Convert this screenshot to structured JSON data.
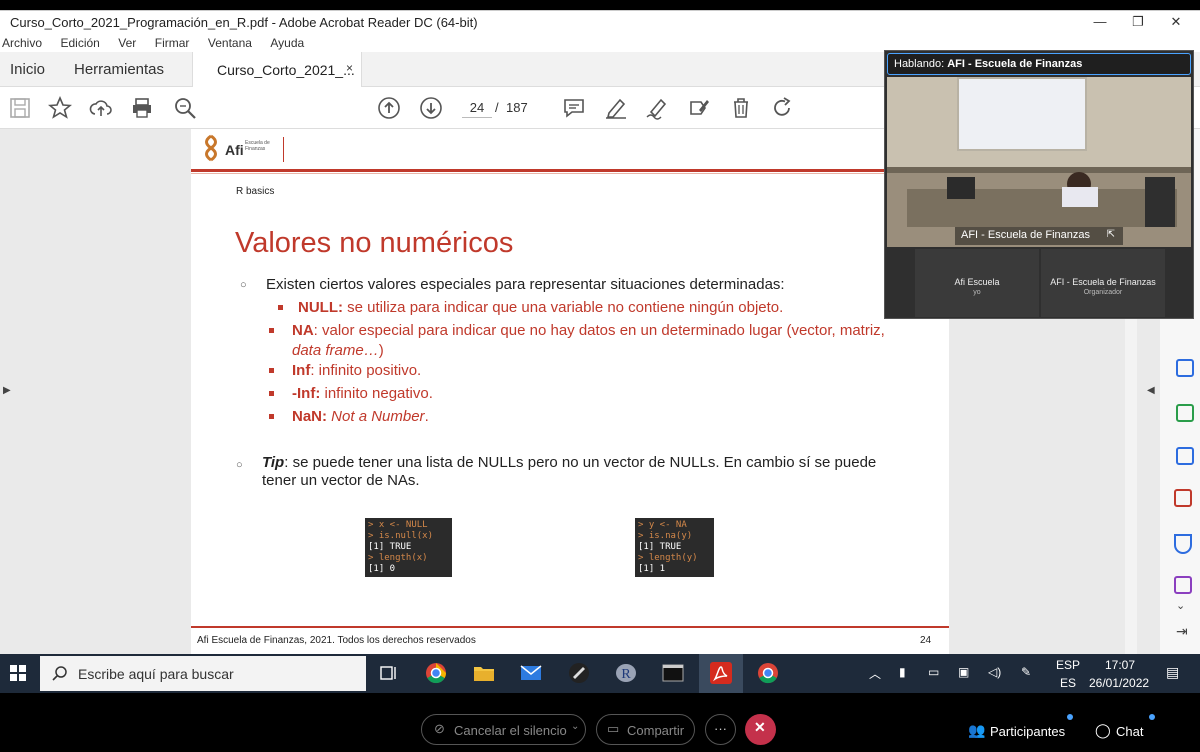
{
  "window": {
    "title": "Curso_Corto_2021_Programación_en_R.pdf - Adobe Acrobat Reader DC (64-bit)"
  },
  "menu": [
    "Archivo",
    "Edición",
    "Ver",
    "Firmar",
    "Ventana",
    "Ayuda"
  ],
  "nav": {
    "home": "Inicio",
    "tools": "Herramientas"
  },
  "tab": {
    "label": "Curso_Corto_2021_...",
    "close": "×"
  },
  "pager": {
    "current": "24",
    "separator": "/",
    "total": "187"
  },
  "slide": {
    "logo_text": "Afi",
    "logo_sub": "Escuela de Finanzas",
    "section": "R basics",
    "title": "Valores no numéricos",
    "bullet1": "Existen ciertos valores especiales para representar situaciones determinadas:",
    "items": [
      {
        "term": "NULL:",
        "desc": " se utiliza para indicar que una variable no contiene ningún objeto."
      },
      {
        "term": "NA",
        "desc": ": valor especial para indicar que no hay datos en un determinado lugar (vector, matriz, ",
        "desc_italic": "data frame…",
        "desc_end": ")"
      },
      {
        "term": "Inf",
        "desc": ": infinito positivo."
      },
      {
        "term": "-Inf:",
        "desc": " infinito negativo."
      },
      {
        "term": "NaN:",
        "desc_italic": " Not a Number",
        "desc_end": "."
      }
    ],
    "tip_term": "Tip",
    "tip_text": ": se puede tener una lista de NULLs pero no un vector de NULLs. En cambio sí se puede tener un vector de NAs.",
    "code1": [
      "> x <- NULL",
      "> is.null(x)",
      "[1] TRUE",
      "> length(x)",
      "[1] 0"
    ],
    "code2": [
      "> y <- NA",
      "> is.na(y)",
      "[1] TRUE",
      "> length(y)",
      "[1] 1"
    ],
    "footer": "Afi Escuela de Finanzas, 2021. Todos los derechos reservados",
    "page_number": "24"
  },
  "meeting": {
    "speaking_prefix": "Hablando:",
    "speaking_name": "AFI - Escuela de Finanzas",
    "video_label": "AFI - Escuela de Finanzas",
    "participants": [
      {
        "name": "Afi Escuela",
        "role": "yo"
      },
      {
        "name": "AFI - Escuela de Finanzas",
        "role": "Organizador"
      }
    ]
  },
  "taskbar": {
    "search_placeholder": "Escribe aquí para buscar",
    "lang1": "ESP",
    "lang2": "ES",
    "time": "17:07",
    "date": "26/01/2022"
  },
  "controls": {
    "unmute": "Cancelar el silencio",
    "share": "Compartir",
    "more": "···",
    "participants": "Participantes",
    "chat": "Chat"
  },
  "colors": {
    "accent_red": "#c0392b",
    "teams_red": "#c4314b",
    "taskbar": "#1e2a3a"
  }
}
